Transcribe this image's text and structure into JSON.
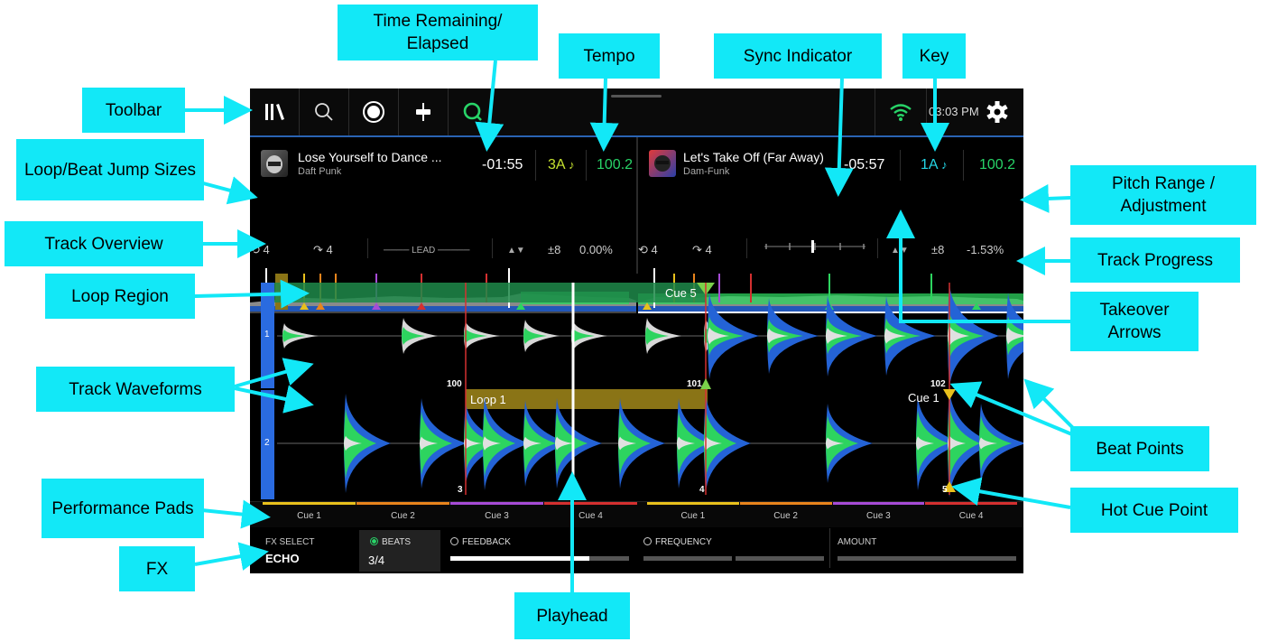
{
  "callouts": {
    "toolbar": "Toolbar",
    "time_remaining": "Time Remaining/ Elapsed",
    "tempo": "Tempo",
    "sync_indicator": "Sync Indicator",
    "key": "Key",
    "loop_beat_jump": "Loop/Beat Jump Sizes",
    "pitch_range": "Pitch Range / Adjustment",
    "track_overview": "Track Overview",
    "track_progress": "Track Progress",
    "loop_region": "Loop Region",
    "takeover_arrows": "Takeover Arrows",
    "track_waveforms": "Track Waveforms",
    "beat_points": "Beat Points",
    "performance_pads": "Performance Pads",
    "hot_cue_point": "Hot Cue Point",
    "fx": "FX",
    "playhead": "Playhead"
  },
  "toolbar": {
    "icons": [
      "library-icon",
      "search-icon",
      "record-icon",
      "fader-icon",
      "quantize-icon"
    ],
    "wifi_icon": "wifi-icon",
    "time": "03:03 PM",
    "settings_icon": "gear-icon"
  },
  "decks": [
    {
      "title": "Lose Yourself to Dance ...",
      "artist": "Daft Punk",
      "time": "-01:55",
      "key": "3A",
      "tempo": "100.2",
      "loop_size": "4",
      "jump_size": "4",
      "lead": "LEAD",
      "pitch_range": "±8",
      "pitch_adjust": "0.00%"
    },
    {
      "title": "Let's Take Off (Far Away)",
      "artist": "Dam-Funk",
      "time": "-05:57",
      "key": "1A",
      "tempo": "100.2",
      "loop_size": "4",
      "jump_size": "4",
      "pitch_range": "±8",
      "pitch_adjust": "-1.53%"
    }
  ],
  "waveform": {
    "deck1_label": "1",
    "deck2_label": "2",
    "cue5": "Cue 5",
    "loop1": "Loop 1",
    "cue1": "Cue 1",
    "beat_100": "100",
    "beat_101": "101",
    "beat_102": "102",
    "beat_3": "3",
    "beat_4": "4",
    "beat_5": "5"
  },
  "pads": {
    "left": [
      "Cue 1",
      "Cue 2",
      "Cue 3",
      "Cue 4"
    ],
    "right": [
      "Cue 1",
      "Cue 2",
      "Cue 3",
      "Cue 4"
    ],
    "colors": [
      "#e8c01c",
      "#e8841c",
      "#a64bd6",
      "#d43030"
    ]
  },
  "fx": {
    "select_label": "FX SELECT",
    "select_value": "ECHO",
    "beats_label": "BEATS",
    "beats_value": "3/4",
    "feedback_label": "FEEDBACK",
    "feedback_level": 0.78,
    "frequency_label": "FREQUENCY",
    "amount_label": "AMOUNT"
  },
  "colors": {
    "callout": "#12e8f7",
    "accent_green": "#28d468",
    "key_yellow": "#c6e230",
    "key_cyan": "#24d6e6",
    "deck_blue": "#2a63b3",
    "loop_gold": "#8a7416"
  }
}
